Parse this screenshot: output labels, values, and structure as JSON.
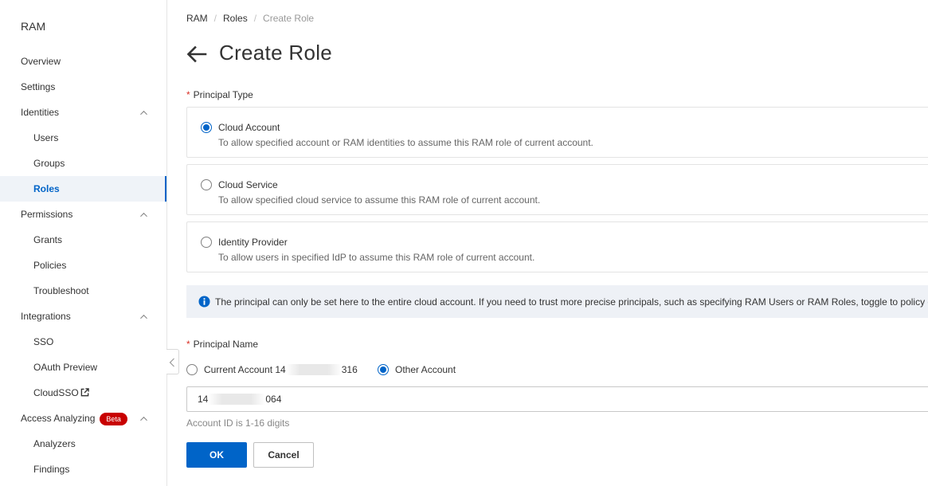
{
  "sidebar": {
    "title": "RAM",
    "items": [
      {
        "label": "Overview"
      },
      {
        "label": "Settings"
      },
      {
        "label": "Identities"
      },
      {
        "label": "Users"
      },
      {
        "label": "Groups"
      },
      {
        "label": "Roles"
      },
      {
        "label": "Permissions"
      },
      {
        "label": "Grants"
      },
      {
        "label": "Policies"
      },
      {
        "label": "Troubleshoot"
      },
      {
        "label": "Integrations"
      },
      {
        "label": "SSO"
      },
      {
        "label": "OAuth Preview"
      },
      {
        "label": "CloudSSO"
      },
      {
        "label": "Access Analyzing",
        "badge": "Beta"
      },
      {
        "label": "Analyzers"
      },
      {
        "label": "Findings"
      }
    ],
    "active_item": "Roles"
  },
  "breadcrumb": [
    "RAM",
    "Roles",
    "Create Role"
  ],
  "page_title": "Create Role",
  "principal_type": {
    "label": "Principal Type",
    "options": [
      {
        "title": "Cloud Account",
        "desc": "To allow specified account or RAM identities to assume this RAM role of current account.",
        "checked": true
      },
      {
        "title": "Cloud Service",
        "desc": "To allow specified cloud service to assume this RAM role of current account.",
        "checked": false
      },
      {
        "title": "Identity Provider",
        "desc": "To allow users in specified IdP to assume this RAM role of current account.",
        "checked": false
      }
    ]
  },
  "notice": "The principal can only be set here to the entire cloud account. If you need to trust more precise principals, such as specifying RAM Users or RAM Roles, toggle to policy editor",
  "principal_name": {
    "label": "Principal Name",
    "current_account_prefix": "Current Account 14",
    "current_account_suffix": "316",
    "other_account_label": "Other Account",
    "selected": "Other Account",
    "input_prefix": "14",
    "input_suffix": "064",
    "help": "Account ID is 1-16 digits"
  },
  "buttons": {
    "ok": "OK",
    "cancel": "Cancel"
  },
  "colors": {
    "primary": "#0064c8",
    "required": "#d93026",
    "beta": "#c80000",
    "notice_bg": "#eef1f6"
  }
}
